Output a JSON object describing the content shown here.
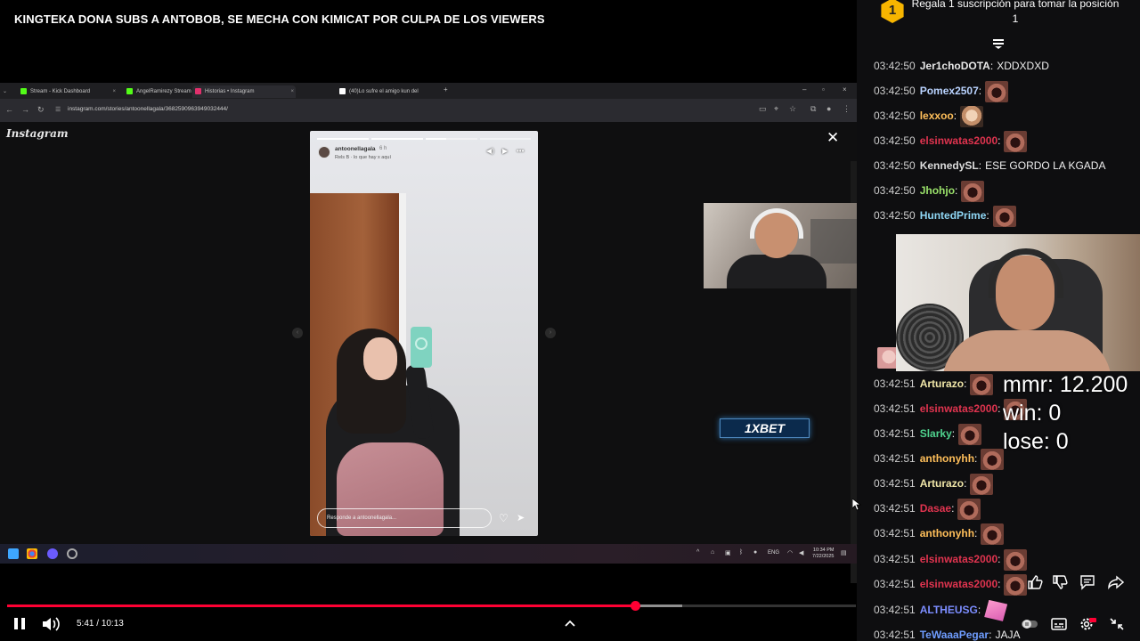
{
  "video": {
    "title": "KINGTEKA DONA SUBS A ANTOBOB, SE MECHA CON KIMICAT POR CULPA DE LOS VIEWERS",
    "current_time": "5:41",
    "duration": "10:13",
    "time_separator": " / ",
    "progress_fraction": 0.74,
    "buffered_fraction": 0.795
  },
  "browser": {
    "tabs": [
      {
        "label": "Stream - Kick Dashboard",
        "icon": "kick-icon",
        "color": "#53fc18"
      },
      {
        "label": "AngelRamirezy Stream",
        "icon": "kick-icon",
        "color": "#53fc18"
      },
      {
        "label": "Historias • Instagram",
        "icon": "instagram-icon",
        "color": "#e1306c"
      },
      {
        "label": "(40)Lo sufre el amigo kun del",
        "icon": "tiktok-icon",
        "color": "#ffffff"
      }
    ],
    "url": "instagram.com/stories/antoonellagala/3682590963949032444/",
    "page_logo": "Instagram",
    "story": {
      "username": "antoonellagala",
      "time_ago": "6 h",
      "song": "Rels B · lo que hay x aquí",
      "reply_placeholder": "Responde a antoonellagala..."
    },
    "ad_badge": "1XBET",
    "taskbar": {
      "lang": "ENG",
      "clock_time": "10:34 PM",
      "clock_date": "7/22/2025"
    }
  },
  "chat": {
    "pinned": {
      "rank": "1",
      "text": "Regala 1 suscripción para tomar la posición 1"
    },
    "messages": [
      {
        "time": "03:42:50",
        "user": "Jer1choDOTA",
        "color": "#e8e8e8",
        "text": "XDDXDXD",
        "emote": ""
      },
      {
        "time": "03:42:50",
        "user": "Pomex2507",
        "color": "#b9d3ff",
        "text": "",
        "emote": "emote"
      },
      {
        "time": "03:42:50",
        "user": "lexxoo",
        "color": "#ffbf5a",
        "text": "",
        "emote": "emote-face"
      },
      {
        "time": "03:42:50",
        "user": "elsinwatas2000",
        "color": "#e0344f",
        "text": "",
        "emote": "emote"
      },
      {
        "time": "03:42:50",
        "user": "KennedySL",
        "color": "#dcdcdc",
        "text": "ESE GORDO LA KGADA",
        "emote": ""
      },
      {
        "time": "03:42:50",
        "user": "Jhohjo",
        "color": "#9be36b",
        "text": "",
        "emote": "emote"
      },
      {
        "time": "03:42:50",
        "user": "HuntedPrime",
        "color": "#8fd7f5",
        "text": "",
        "emote": "emote"
      },
      {
        "time": "03:42:51",
        "user": "Arturazo",
        "color": "#f0e6a8",
        "text": "",
        "emote": "emote"
      },
      {
        "time": "03:42:51",
        "user": "elsinwatas2000",
        "color": "#e0344f",
        "text": "",
        "emote": "emote"
      },
      {
        "time": "03:42:51",
        "user": "Slarky",
        "color": "#4fd38e",
        "text": "",
        "emote": "emote"
      },
      {
        "time": "03:42:51",
        "user": "anthonyhh",
        "color": "#ffbf5a",
        "text": "",
        "emote": "emote"
      },
      {
        "time": "03:42:51",
        "user": "Arturazo",
        "color": "#f0e6a8",
        "text": "",
        "emote": "emote"
      },
      {
        "time": "03:42:51",
        "user": "Dasae",
        "color": "#e0344f",
        "text": "",
        "emote": "emote"
      },
      {
        "time": "03:42:51",
        "user": "anthonyhh",
        "color": "#ffbf5a",
        "text": "",
        "emote": "emote"
      },
      {
        "time": "03:42:51",
        "user": "elsinwatas2000",
        "color": "#e0344f",
        "text": "",
        "emote": "emote"
      },
      {
        "time": "03:42:51",
        "user": "elsinwatas2000",
        "color": "#e0344f",
        "text": "",
        "emote": "emote"
      },
      {
        "time": "03:42:51",
        "user": "ALTHEUSG",
        "color": "#7c8dff",
        "text": "",
        "emote": "emote-pink"
      },
      {
        "time": "03:42:51",
        "user": "TeWaaaPegar",
        "color": "#6f9dff",
        "text": "JAJA",
        "emote": ""
      }
    ]
  },
  "stats": {
    "mmr": "mmr: 12.200",
    "win": "win: 0",
    "lose": "lose: 0"
  }
}
